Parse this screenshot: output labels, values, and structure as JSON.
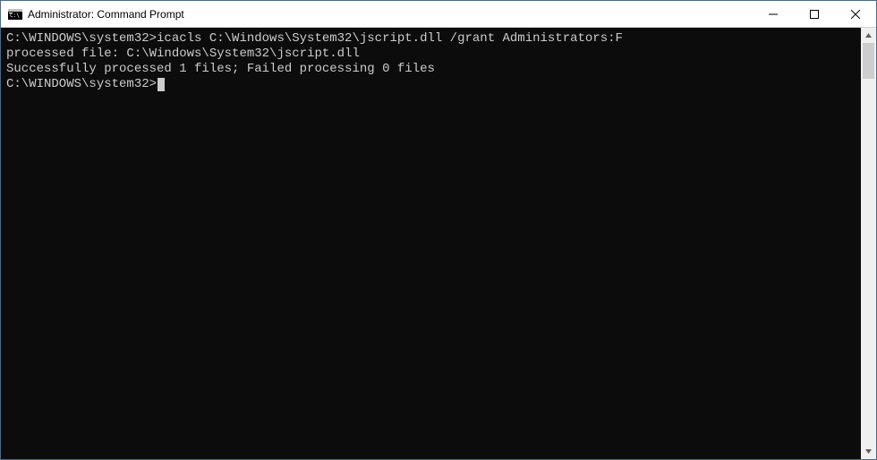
{
  "window": {
    "title": "Administrator: Command Prompt"
  },
  "terminal": {
    "lines": [
      "C:\\WINDOWS\\system32>icacls C:\\Windows\\System32\\jscript.dll /grant Administrators:F",
      "processed file: C:\\Windows\\System32\\jscript.dll",
      "Successfully processed 1 files; Failed processing 0 files",
      "",
      "C:\\WINDOWS\\system32>"
    ],
    "prompt_index": 4
  }
}
